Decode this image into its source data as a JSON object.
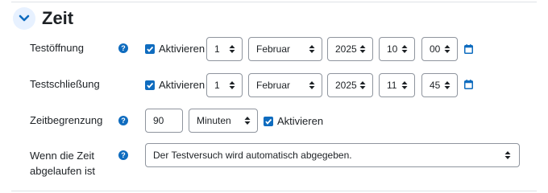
{
  "section": {
    "title": "Zeit"
  },
  "rows": {
    "open": {
      "label": "Testöffnung",
      "enable_label": "Aktivieren",
      "day": "1",
      "month": "Februar",
      "year": "2025",
      "hour": "10",
      "minute": "00"
    },
    "close": {
      "label": "Testschließung",
      "enable_label": "Aktivieren",
      "day": "1",
      "month": "Februar",
      "year": "2025",
      "hour": "11",
      "minute": "45"
    },
    "limit": {
      "label": "Zeitbegrenzung",
      "value": "90",
      "unit": "Minuten",
      "enable_label": "Aktivieren"
    },
    "expiry": {
      "label_line1": "Wenn die Zeit",
      "label_line2": "abgelaufen ist",
      "value": "Der Testversuch wird automatisch abgegeben."
    }
  },
  "icons": {
    "help": "question-circle-icon",
    "calendar": "calendar-icon",
    "collapse": "chevron-down-icon",
    "select_caret": "up-down-caret-icon",
    "check": "checkmark-icon"
  },
  "colors": {
    "accent": "#0f6cbf",
    "help": "#0f6cbf",
    "header_circle": "#e7f1ff",
    "border": "#8f959e",
    "divider": "#dee2e6",
    "text": "#1d2125"
  }
}
